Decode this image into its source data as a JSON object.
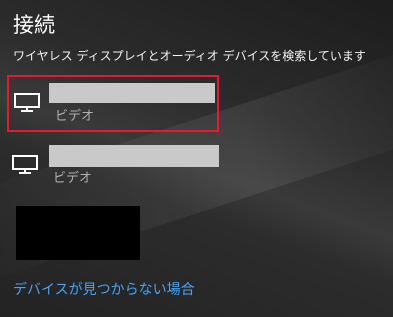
{
  "panel": {
    "title": "接続",
    "status": "ワイヤレス ディスプレイとオーディオ デバイスを検索しています"
  },
  "devices": [
    {
      "name": "",
      "type": "ビデオ",
      "icon": "monitor-icon",
      "selected": true
    },
    {
      "name": "",
      "type": "ビデオ",
      "icon": "monitor-icon",
      "selected": false
    }
  ],
  "help_link": "デバイスが見つからない場合",
  "colors": {
    "selection_border": "#e41b2a",
    "link": "#47a3f5",
    "redaction_bar": "#c9c9c9"
  }
}
